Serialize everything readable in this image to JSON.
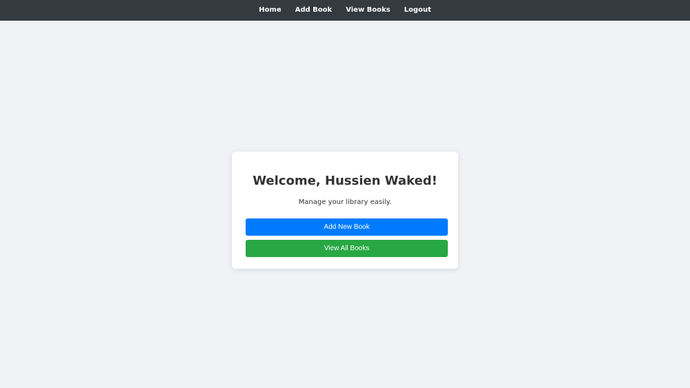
{
  "nav": {
    "items": [
      {
        "label": "Home"
      },
      {
        "label": "Add Book"
      },
      {
        "label": "View Books"
      },
      {
        "label": "Logout"
      }
    ]
  },
  "card": {
    "title": "Welcome, Hussien Waked!",
    "subtitle": "Manage your library easily.",
    "add_button_label": "Add New Book",
    "view_button_label": "View All Books"
  },
  "colors": {
    "navbar_bg": "#343a40",
    "page_bg": "#f0f2f5",
    "primary": "#007bff",
    "success": "#28a745"
  }
}
